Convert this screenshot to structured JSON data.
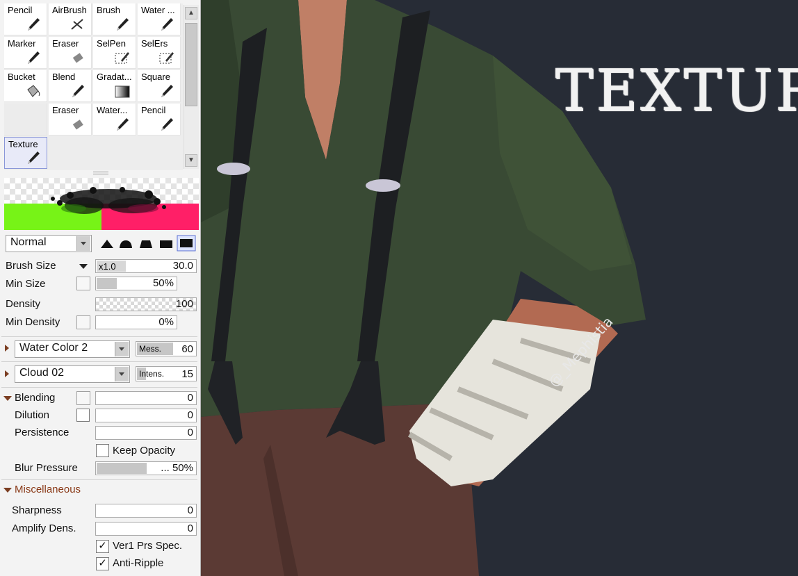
{
  "tools": [
    {
      "label": "Pencil",
      "icon": "pencil-icon"
    },
    {
      "label": "AirBrush",
      "icon": "airbrush-icon"
    },
    {
      "label": "Brush",
      "icon": "brush-icon"
    },
    {
      "label": "Water ...",
      "icon": "water-brush-icon"
    },
    {
      "label": "Marker",
      "icon": "marker-icon"
    },
    {
      "label": "Eraser",
      "icon": "eraser-icon"
    },
    {
      "label": "SelPen",
      "icon": "selpen-icon"
    },
    {
      "label": "SelErs",
      "icon": "selers-icon"
    },
    {
      "label": "Bucket",
      "icon": "bucket-icon"
    },
    {
      "label": "Blend",
      "icon": "blend-icon"
    },
    {
      "label": "Gradat...",
      "icon": "gradation-icon"
    },
    {
      "label": "Square",
      "icon": "square-brush-icon"
    },
    {
      "label": "",
      "icon": ""
    },
    {
      "label": "Eraser",
      "icon": "eraser-icon"
    },
    {
      "label": "Water...",
      "icon": "water-brush-icon"
    },
    {
      "label": "Pencil",
      "icon": "pencil-icon"
    },
    {
      "label": "Texture",
      "icon": "texture-brush-icon",
      "selected": true
    }
  ],
  "preview": {
    "left_color": "#77f317",
    "right_color": "#ff1f67"
  },
  "blend_mode": "Normal",
  "brush_size": {
    "label": "Brush Size",
    "multiplier": "x1.0",
    "value": "30.0"
  },
  "min_size": {
    "label": "Min Size",
    "value": "50%",
    "level": 0.5
  },
  "density": {
    "label": "Density",
    "value": "100",
    "level": 1.0
  },
  "min_density": {
    "label": "Min Density",
    "value": "0%",
    "level": 0
  },
  "paper_texture": {
    "name": "Water Color 2",
    "param_label": "Mess.",
    "value": "60"
  },
  "brush_texture": {
    "name": "Cloud 02",
    "param_label": "Intens.",
    "value": "15"
  },
  "blending_section": {
    "title": "Blending",
    "blending": {
      "label": "Blending",
      "value": "0"
    },
    "dilution": {
      "label": "Dilution",
      "value": "0"
    },
    "persistence": {
      "label": "Persistence",
      "value": "0"
    },
    "keep_opacity": {
      "label": "Keep Opacity",
      "checked": false
    },
    "blur_pressure": {
      "label": "Blur Pressure",
      "value": "... 50%",
      "level": 0.5
    }
  },
  "misc_section": {
    "title": "Miscellaneous",
    "sharpness": {
      "label": "Sharpness",
      "value": "0"
    },
    "amplify": {
      "label": "Amplify Dens.",
      "value": "0"
    },
    "ver1": {
      "label": "Ver1 Prs Spec.",
      "checked": true,
      "mark": "✓"
    },
    "anti_ripple": {
      "label": "Anti-Ripple",
      "checked": true,
      "mark": "✓"
    }
  },
  "canvas": {
    "title_text": "TEXTURE",
    "watermark": "@_Mephistia",
    "background": "#272c36"
  }
}
